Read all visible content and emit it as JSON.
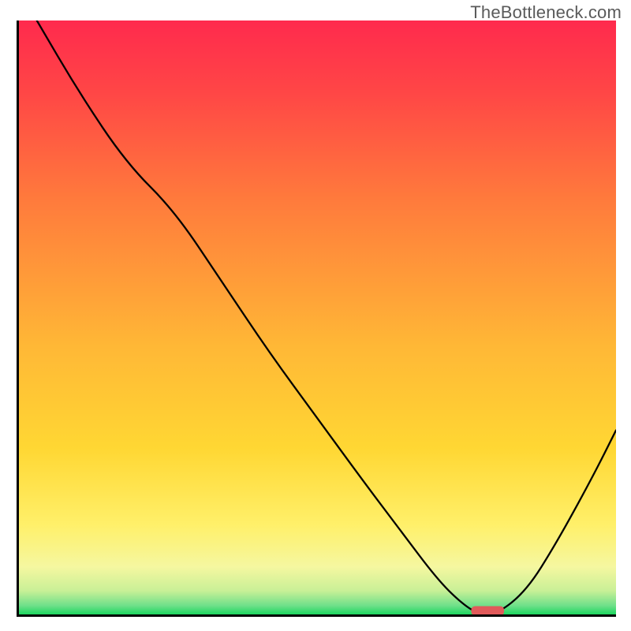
{
  "watermark": "TheBottleneck.com",
  "chart_data": {
    "type": "line",
    "title": "",
    "xlabel": "",
    "ylabel": "",
    "xlim": [
      0,
      100
    ],
    "ylim": [
      0,
      100
    ],
    "grid": false,
    "legend": false,
    "background_gradient": {
      "top_color": "#ff2a4d",
      "mid_color_1": "#ff7a3c",
      "mid_color_2": "#ffd733",
      "lower_color": "#faf79a",
      "bottom_color": "#1dd65f"
    },
    "x": [
      3,
      10,
      18,
      26,
      34,
      42,
      50,
      58,
      64,
      70,
      74,
      77,
      80,
      85,
      90,
      96,
      100
    ],
    "values": [
      100,
      88,
      76,
      68,
      56,
      44,
      33,
      22,
      14,
      6,
      2,
      0,
      0,
      4,
      12,
      23,
      31
    ],
    "marker": {
      "x_center": 78.5,
      "y": 0.6,
      "width": 5.5,
      "height": 1.6
    },
    "notes": "Bottleneck percentage curve dipping to zero near x≈78 then rising; rainbow background gradient red→green."
  }
}
